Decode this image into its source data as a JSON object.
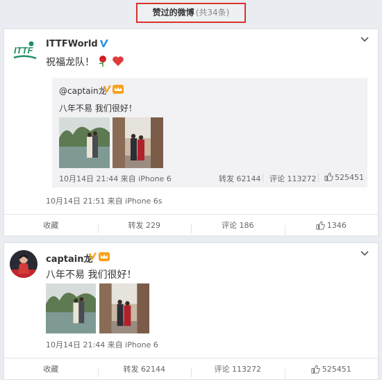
{
  "header": {
    "title": "赞过的微博",
    "count": "(共34条)"
  },
  "post1": {
    "username": "ITTFWorld",
    "text": "祝福龙队！",
    "quote": {
      "username": "@captain龙",
      "text": "八年不易 我们很好！",
      "meta": "10月14日 21:44 来自 iPhone 6",
      "repost": "转发 62144",
      "comment": "评论 113272",
      "like": "525451"
    },
    "meta": "10月14日 21:51 来自 iPhone 6s",
    "actions": {
      "fav": "收藏",
      "repost": "转发 229",
      "comment": "评论 186",
      "like": "1346"
    }
  },
  "post2": {
    "username": "captain龙",
    "text": "八年不易 我们很好！",
    "meta": "10月14日 21:44 来自 iPhone 6",
    "actions": {
      "fav": "收藏",
      "repost": "转发 62144",
      "comment": "评论 113272",
      "like": "525451"
    }
  },
  "icons": [
    "verified-v-icon",
    "vip-crown-icon",
    "rose-emoji-icon",
    "heart-emoji-icon",
    "chevron-down-icon",
    "thumb-up-icon"
  ],
  "colors": {
    "verified": "#1d8fe1",
    "highlight_box": "#d9312b",
    "vip": "#f7a21b",
    "heart": "#e03a3a"
  }
}
